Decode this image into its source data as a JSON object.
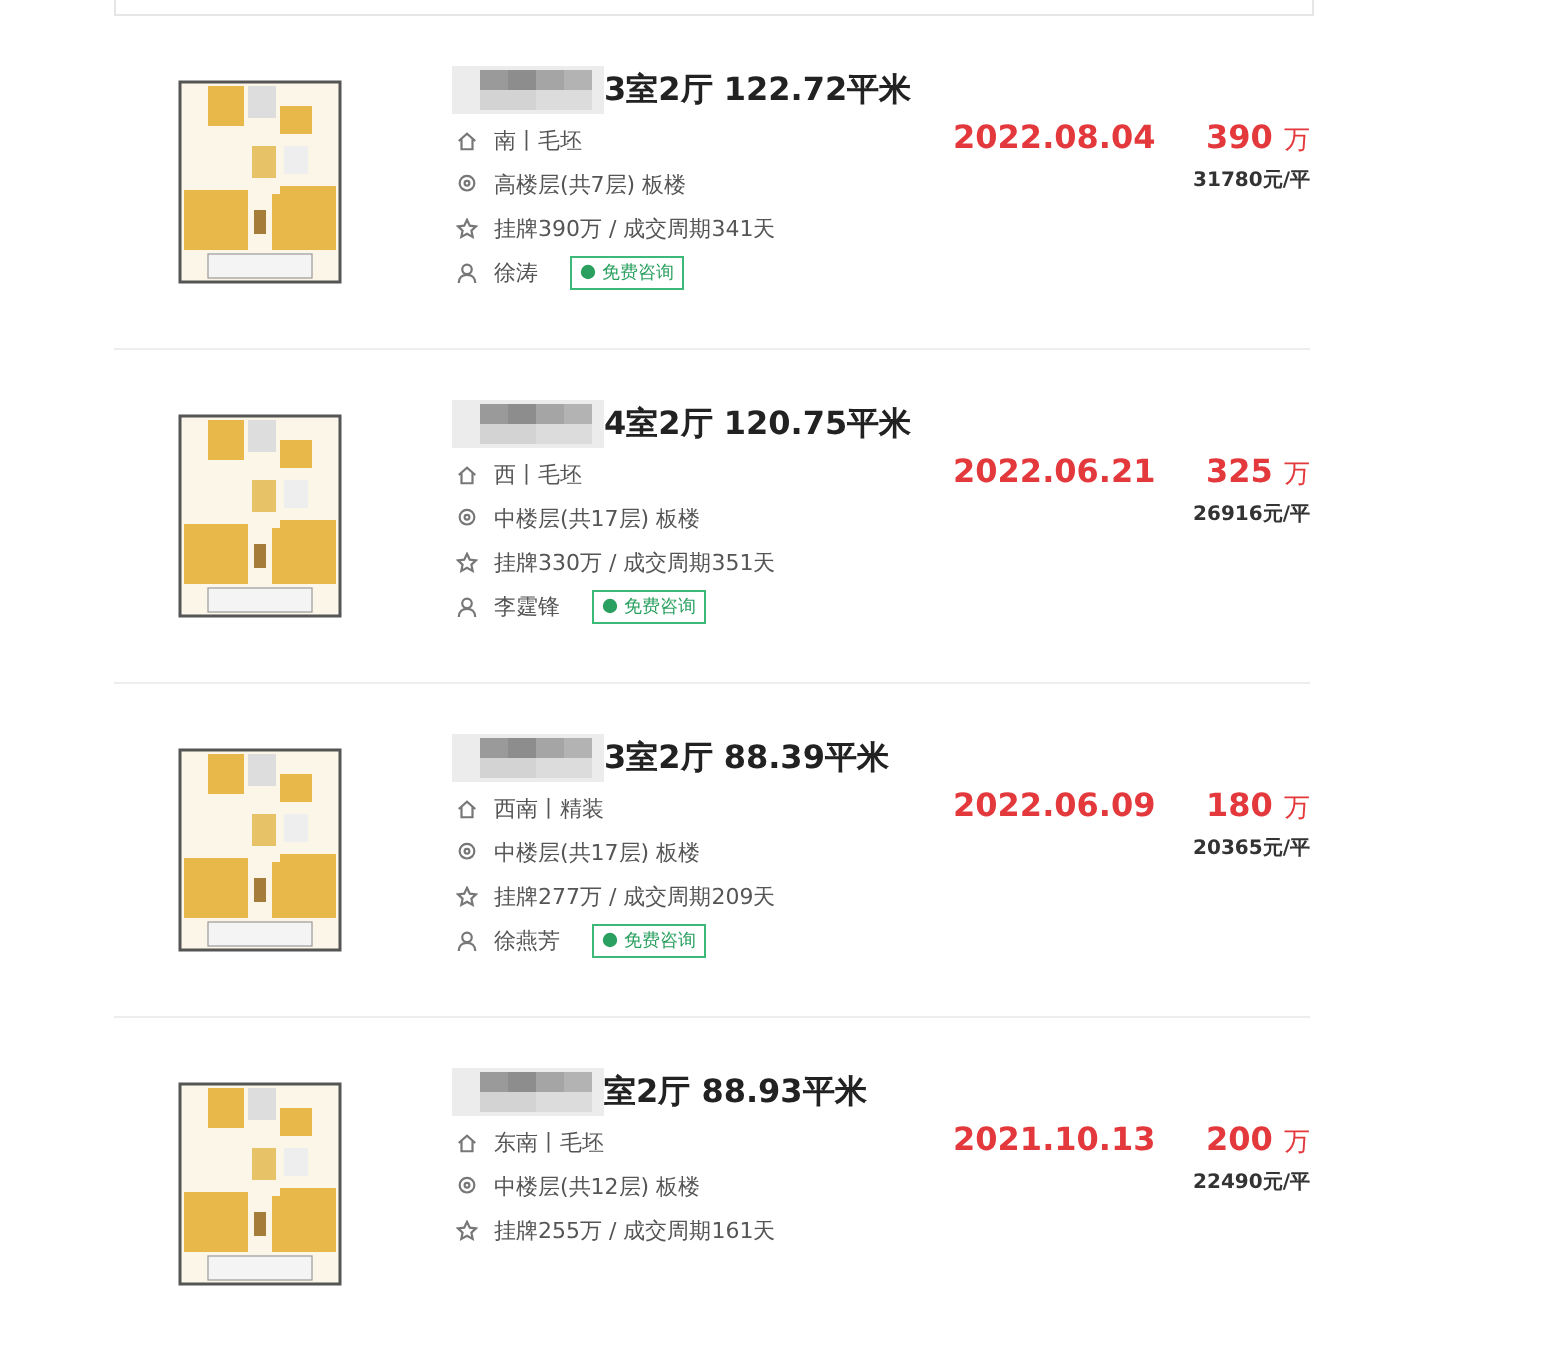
{
  "listings": [
    {
      "title": "3室2厅 122.72平米",
      "orientation": "南丨毛坯",
      "floor": "高楼层(共7层) 板楼",
      "stats": "挂牌390万 / 成交周期341天",
      "agent": "徐涛",
      "consult": "免费咨询",
      "date": "2022.08.04",
      "price": "390",
      "price_unit": "万",
      "unit_price": "31780元/平"
    },
    {
      "title": "4室2厅 120.75平米",
      "orientation": "西丨毛坯",
      "floor": "中楼层(共17层) 板楼",
      "stats": "挂牌330万 / 成交周期351天",
      "agent": "李霆锋",
      "consult": "免费咨询",
      "date": "2022.06.21",
      "price": "325",
      "price_unit": "万",
      "unit_price": "26916元/平"
    },
    {
      "title": "3室2厅 88.39平米",
      "orientation": "西南丨精装",
      "floor": "中楼层(共17层) 板楼",
      "stats": "挂牌277万 / 成交周期209天",
      "agent": "徐燕芳",
      "consult": "免费咨询",
      "date": "2022.06.09",
      "price": "180",
      "price_unit": "万",
      "unit_price": "20365元/平"
    },
    {
      "title": "室2厅 88.93平米",
      "orientation": "东南丨毛坯",
      "floor": "中楼层(共12层) 板楼",
      "stats": "挂牌255万 / 成交周期161天",
      "date": "2021.10.13",
      "price": "200",
      "price_unit": "万",
      "unit_price": "22490元/平"
    }
  ]
}
